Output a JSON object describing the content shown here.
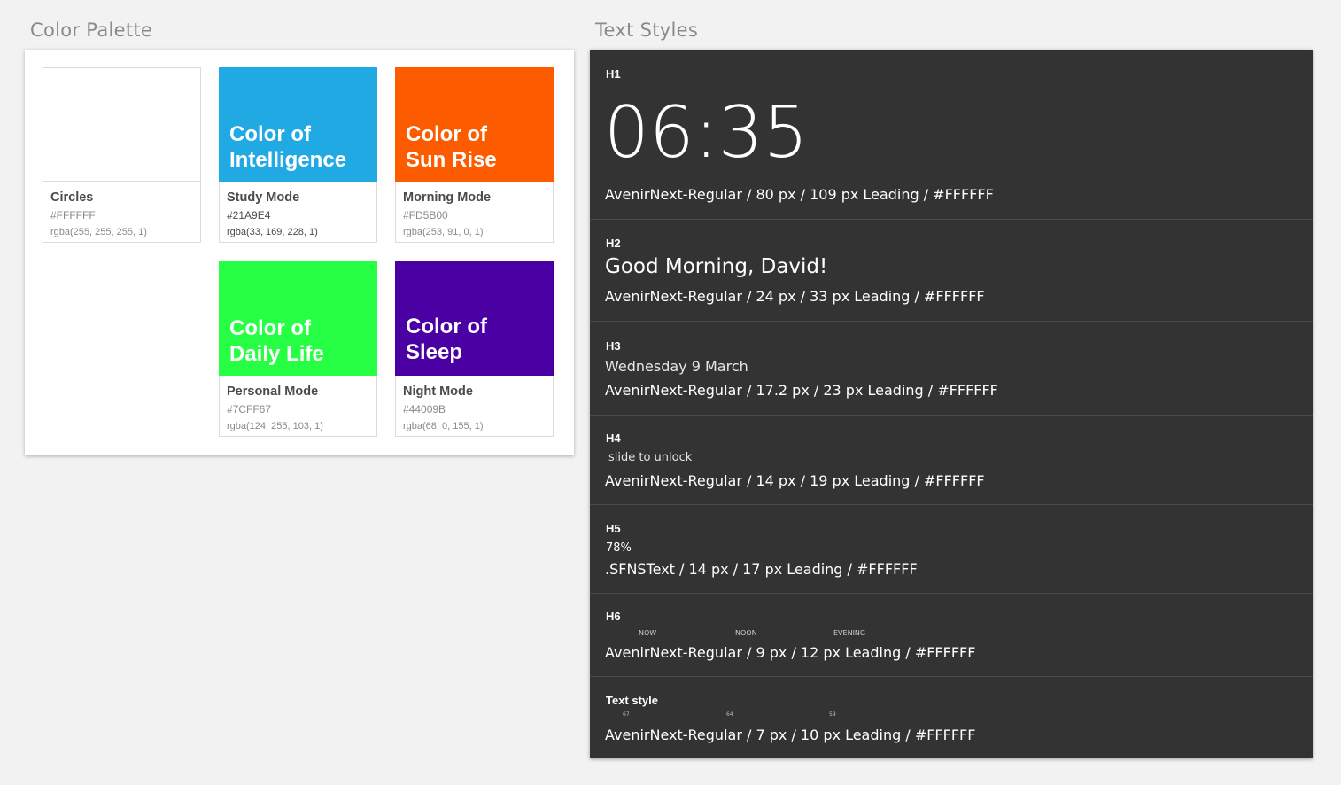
{
  "color_palette": {
    "title": "Color Palette",
    "swatches": [
      {
        "heading_line1": "",
        "heading_line2": "",
        "name": "Circles",
        "hex": "#FFFFFF",
        "rgba": "rgba(255, 255, 255, 1)",
        "color": "#FFFFFF"
      },
      {
        "heading_line1": "Color of",
        "heading_line2": "Intelligence",
        "name": "Study Mode",
        "hex": "#21A9E4",
        "rgba": "rgba(33, 169, 228, 1)",
        "color": "#21A9E4"
      },
      {
        "heading_line1": "Color of",
        "heading_line2": "Sun Rise",
        "name": "Morning Mode",
        "hex": "#FD5B00",
        "rgba": "rgba(253, 91, 0, 1)",
        "color": "#FD5B00"
      },
      {
        "heading_line1": "Color of",
        "heading_line2": "Daily Life",
        "name": "Personal Mode",
        "hex": "#7CFF67",
        "rgba": "rgba(124, 255, 103, 1)",
        "color": "#27FF44"
      },
      {
        "heading_line1": "Color of",
        "heading_line2": "Sleep",
        "name": "Night Mode",
        "hex": "#44009B",
        "rgba": "rgba(68, 0, 155, 1)",
        "color": "#4A00A3"
      }
    ]
  },
  "text_styles": {
    "title": "Text Styles",
    "rows": [
      {
        "label": "H1",
        "sample": "06:35",
        "spec": "AvenirNext-Regular / 80 px / 109 px Leading / #FFFFFF"
      },
      {
        "label": "H2",
        "sample": "Good Morning, David!",
        "spec": "AvenirNext-Regular / 24 px / 33 px Leading / #FFFFFF"
      },
      {
        "label": "H3",
        "sample": "Wednesday 9 March",
        "spec": "AvenirNext-Regular / 17.2 px / 23 px Leading / #FFFFFF"
      },
      {
        "label": "H4",
        "sample": "slide to unlock",
        "spec": "AvenirNext-Regular / 14 px / 19 px Leading / #FFFFFF"
      },
      {
        "label": "H5",
        "sample": "78%",
        "spec": ".SFNSText / 14 px / 17 px Leading / #FFFFFF"
      },
      {
        "label": "H6",
        "sample_items": [
          "NOW",
          "NOON",
          "EVENING"
        ],
        "spec": "AvenirNext-Regular / 9 px / 12 px Leading / #FFFFFF"
      },
      {
        "label": "Text style",
        "sample_items": [
          "67",
          "64",
          "59"
        ],
        "spec": "AvenirNext-Regular / 7 px / 10 px Leading / #FFFFFF"
      }
    ]
  }
}
